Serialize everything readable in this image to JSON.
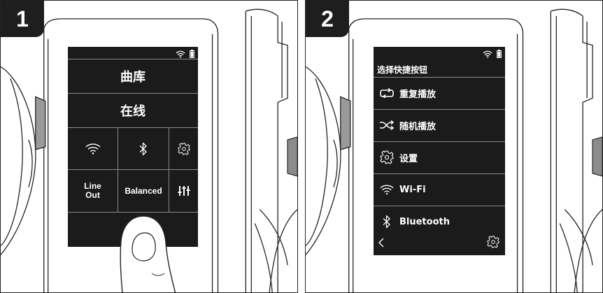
{
  "panels": [
    {
      "step": "1",
      "tiles": {
        "library": "曲库",
        "online": "在线"
      },
      "grid": {
        "line_out": "Line\nOut",
        "balanced": "Balanced"
      },
      "icons": [
        "wifi-icon",
        "bluetooth-icon",
        "settings-gear-icon",
        "equalizer-icon",
        "battery-icon"
      ]
    },
    {
      "step": "2",
      "title": "选择快捷按钮",
      "menu": [
        {
          "label": "重复播放",
          "icon": "repeat-icon"
        },
        {
          "label": "随机播放",
          "icon": "shuffle-icon"
        },
        {
          "label": "设置",
          "icon": "settings-gear-icon"
        },
        {
          "label": "Wi-Fi",
          "icon": "wifi-icon"
        },
        {
          "label": "Bluetooth",
          "icon": "bluetooth-icon"
        }
      ],
      "footer_icons": [
        "back-arrow-icon",
        "settings-gear-icon"
      ]
    }
  ]
}
